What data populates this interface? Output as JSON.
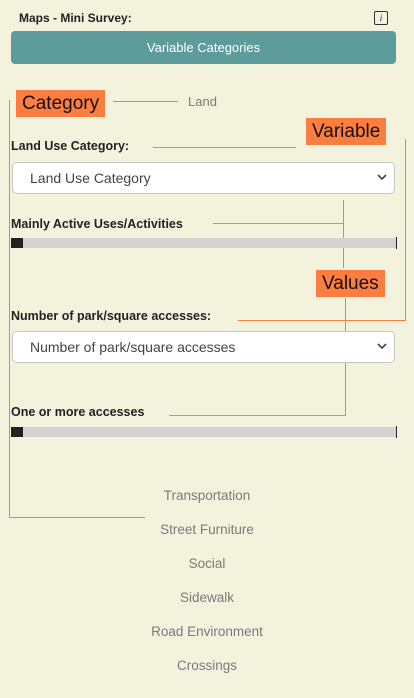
{
  "header": {
    "title": "Maps - Mini Survey:",
    "info_icon": "i",
    "button_label": "Variable Categories"
  },
  "annotations": {
    "category": "Category",
    "variable": "Variable",
    "values": "Values"
  },
  "current_category": "Land",
  "questions": [
    {
      "label": "Land Use Category:",
      "select_value": "Land Use Category",
      "result_label": "Mainly Active Uses/Activities",
      "fill_fraction": 0.03
    },
    {
      "label": "Number of park/square accesses:",
      "select_value": "Number of park/square accesses",
      "result_label": "One or more accesses",
      "fill_fraction": 0.03
    }
  ],
  "categories": [
    "Transportation",
    "Street Furniture",
    "Social",
    "Sidewalk",
    "Road Environment",
    "Crossings"
  ],
  "colors": {
    "accent": "#5e9c9c",
    "annotation": "#fb7e40",
    "background": "#f3f2dd"
  }
}
